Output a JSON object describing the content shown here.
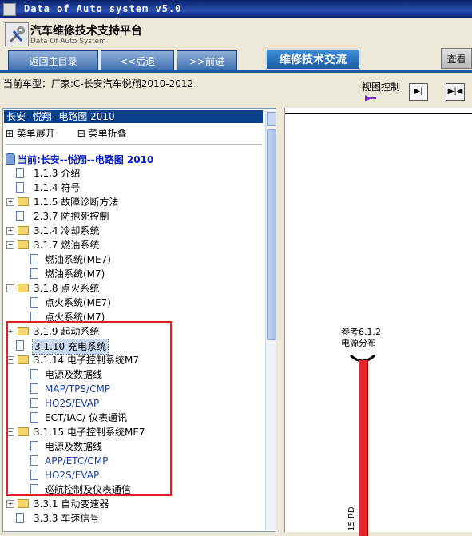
{
  "window": {
    "title": "Data of Auto system v5.0"
  },
  "banner": {
    "title": "汽车维修技术支持平台",
    "subtitle": "Data Of Auto System"
  },
  "nav": {
    "back_main": "返回主目录",
    "back": "<<后退",
    "forward": ">>前进",
    "exchange": "维修技术交流",
    "view": "查看"
  },
  "info": {
    "current_model": "当前车型：厂家:C-长安汽车悦翔2010-2012",
    "view_control": "视图控制"
  },
  "tree": {
    "selected_header": "长安--悦翔--电路图 2010",
    "menu_expand": "菜单展开",
    "menu_collapse": "菜单折叠",
    "current": "当前:长安--悦翔--电路图 2010",
    "nodes": [
      {
        "label": "1.1.3 介绍"
      },
      {
        "label": "1.1.4 符号"
      },
      {
        "label": "1.1.5 故障诊断方法"
      },
      {
        "label": "2.3.7 防抱死控制"
      },
      {
        "label": "3.1.4 冷却系统"
      },
      {
        "label": "3.1.7 燃油系统"
      },
      {
        "label": "燃油系统(ME7)"
      },
      {
        "label": "燃油系统(M7)"
      },
      {
        "label": "3.1.8 点火系统"
      },
      {
        "label": "点火系统(ME7)"
      },
      {
        "label": "点火系统(M7)"
      },
      {
        "label": "3.1.9 起动系统"
      },
      {
        "label": "3.1.10 充电系统"
      },
      {
        "label": "3.1.14 电子控制系统M7"
      },
      {
        "label": "电源及数据线"
      },
      {
        "label": "MAP/TPS/CMP"
      },
      {
        "label": "HO2S/EVAP"
      },
      {
        "label": "ECT/IAC/ 仪表通讯"
      },
      {
        "label": "3.1.15 电子控制系统ME7"
      },
      {
        "label": "电源及数据线"
      },
      {
        "label": "APP/ETC/CMP"
      },
      {
        "label": "HO2S/EVAP"
      },
      {
        "label": "巡航控制及仪表通信"
      },
      {
        "label": "3.3.1 自动变速器"
      },
      {
        "label": "3.3.3 车速信号"
      }
    ]
  },
  "diagram": {
    "ref_line1": "参考6.1.2",
    "ref_line2": "电源分布",
    "wire_label": "15 RD"
  }
}
